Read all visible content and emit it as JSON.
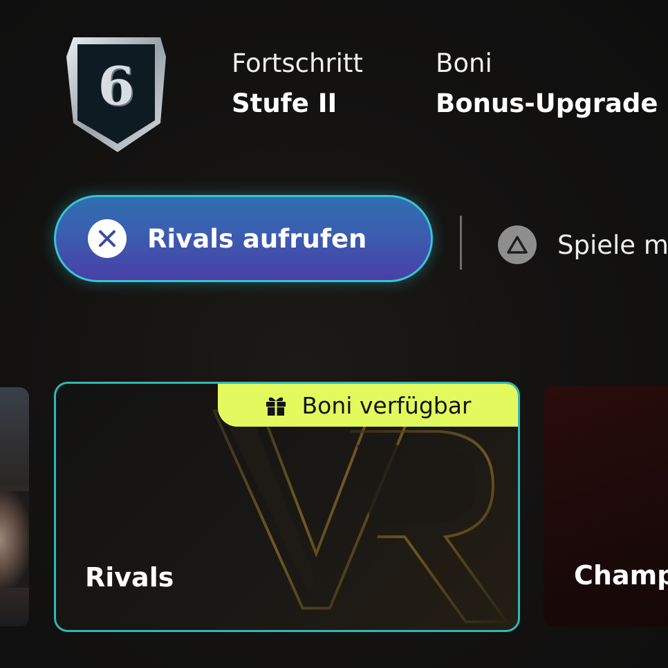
{
  "rank": {
    "number": "6"
  },
  "progress": {
    "label": "Fortschritt",
    "value": "Stufe II"
  },
  "bonus": {
    "label": "Boni",
    "value": "Bonus-Upgrade"
  },
  "actions": {
    "primary_label": "Rivals aufrufen",
    "primary_icon": "cross-button-icon",
    "secondary_label": "Spiele m",
    "secondary_icon": "triangle-button-icon"
  },
  "cards": {
    "rivals": {
      "title": "Rivals",
      "tag_label": "Boni verfügbar",
      "tag_icon": "gift-icon"
    },
    "next": {
      "title": "Champ"
    }
  },
  "colors": {
    "accent_teal": "#2fb9b5",
    "tag_yellow": "#e3fa5e",
    "button_blue": "#2f6fb0",
    "button_purple": "#4a3fa6"
  }
}
